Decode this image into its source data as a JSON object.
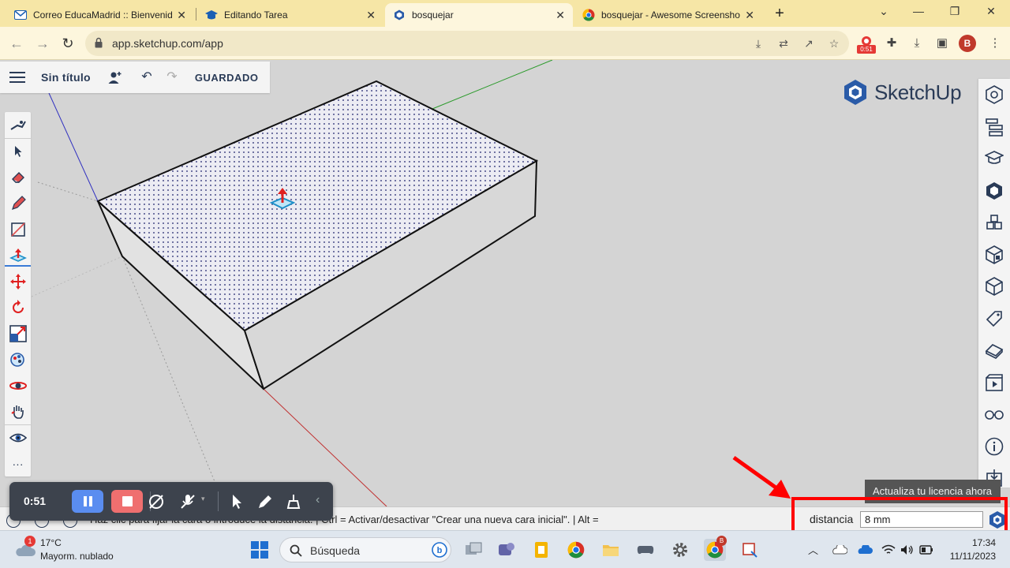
{
  "browser": {
    "tabs": [
      {
        "title": "Correo EducaMadrid :: Bienvenid",
        "active": false
      },
      {
        "title": "Editando Tarea",
        "active": false
      },
      {
        "title": "bosquejar",
        "active": true
      },
      {
        "title": "bosquejar - Awesome Screensho",
        "active": false
      }
    ],
    "close_glyph": "✕",
    "new_tab_glyph": "+",
    "window_controls": {
      "minimize": "—",
      "restore": "❐",
      "close": "✕",
      "collapse": "⌄"
    },
    "url": "app.sketchup.com/app",
    "extension_badge_time": "0:51",
    "profile_initial": "B"
  },
  "sketchup": {
    "file_title": "Sin título",
    "saved_status": "GUARDADO",
    "logo_text": "SketchUp",
    "license_banner": "Actualiza tu licencia ahora",
    "status_hint": "Haz clic para fijar la cara o introduce la distancia. | Ctrl = Activar/desactivar \"Crear una nueva cara inicial\". | Alt =",
    "vcb_label": "distancia",
    "vcb_value": "8 mm",
    "left_tools": [
      "walk-icon",
      "select-icon",
      "eraser-icon",
      "pencil-icon",
      "shape-icon",
      "push-pull-icon",
      "move-icon",
      "rotate-icon",
      "scale-icon",
      "paint-bucket-icon",
      "orbit-icon",
      "pan-icon",
      "view-eye-icon",
      "more-icon"
    ],
    "right_tools": [
      "entity-info-icon",
      "outliner-icon",
      "instructor-icon",
      "components-icon",
      "materials-icon",
      "solid-tools-icon",
      "styles-icon",
      "tags-icon",
      "scenes-icon",
      "display-icon",
      "glasses-icon",
      "info-icon",
      "export-icon"
    ]
  },
  "recorder": {
    "time": "0:51"
  },
  "taskbar": {
    "weather_badge": "1",
    "temperature": "17°C",
    "condition": "Mayorm. nublado",
    "search_placeholder": "Búsqueda",
    "time": "17:34",
    "date": "11/11/2023",
    "chrome_badge": "B"
  },
  "colors": {
    "tabbar": "#f6e6a6",
    "toolbar": "#fdf6dd",
    "sketchup_navy": "#2a3b57",
    "highlight_red": "#ff0000",
    "recorder_bg": "#3d434d"
  }
}
